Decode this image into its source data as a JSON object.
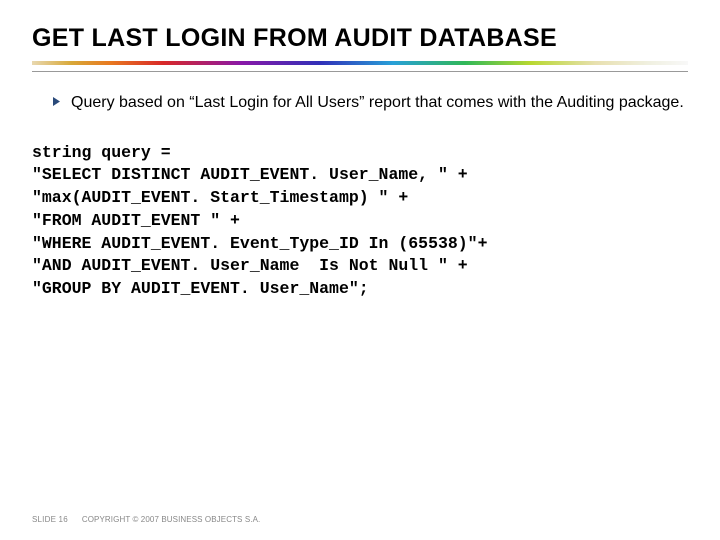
{
  "title": "GET LAST LOGIN FROM AUDIT DATABASE",
  "bullet": "Query based on “Last Login for All Users” report that comes with the Auditing package.",
  "code": "string query =\n\"SELECT DISTINCT AUDIT_EVENT. User_Name, \" +\n\"max(AUDIT_EVENT. Start_Timestamp) \" +\n\"FROM AUDIT_EVENT \" +\n\"WHERE AUDIT_EVENT. Event_Type_ID In (65538)\"+\n\"AND AUDIT_EVENT. User_Name  Is Not Null \" +\n\"GROUP BY AUDIT_EVENT. User_Name\";",
  "footer": {
    "slide_label": "SLIDE 16",
    "copyright": "COPYRIGHT © 2007 BUSINESS OBJECTS S.A."
  }
}
